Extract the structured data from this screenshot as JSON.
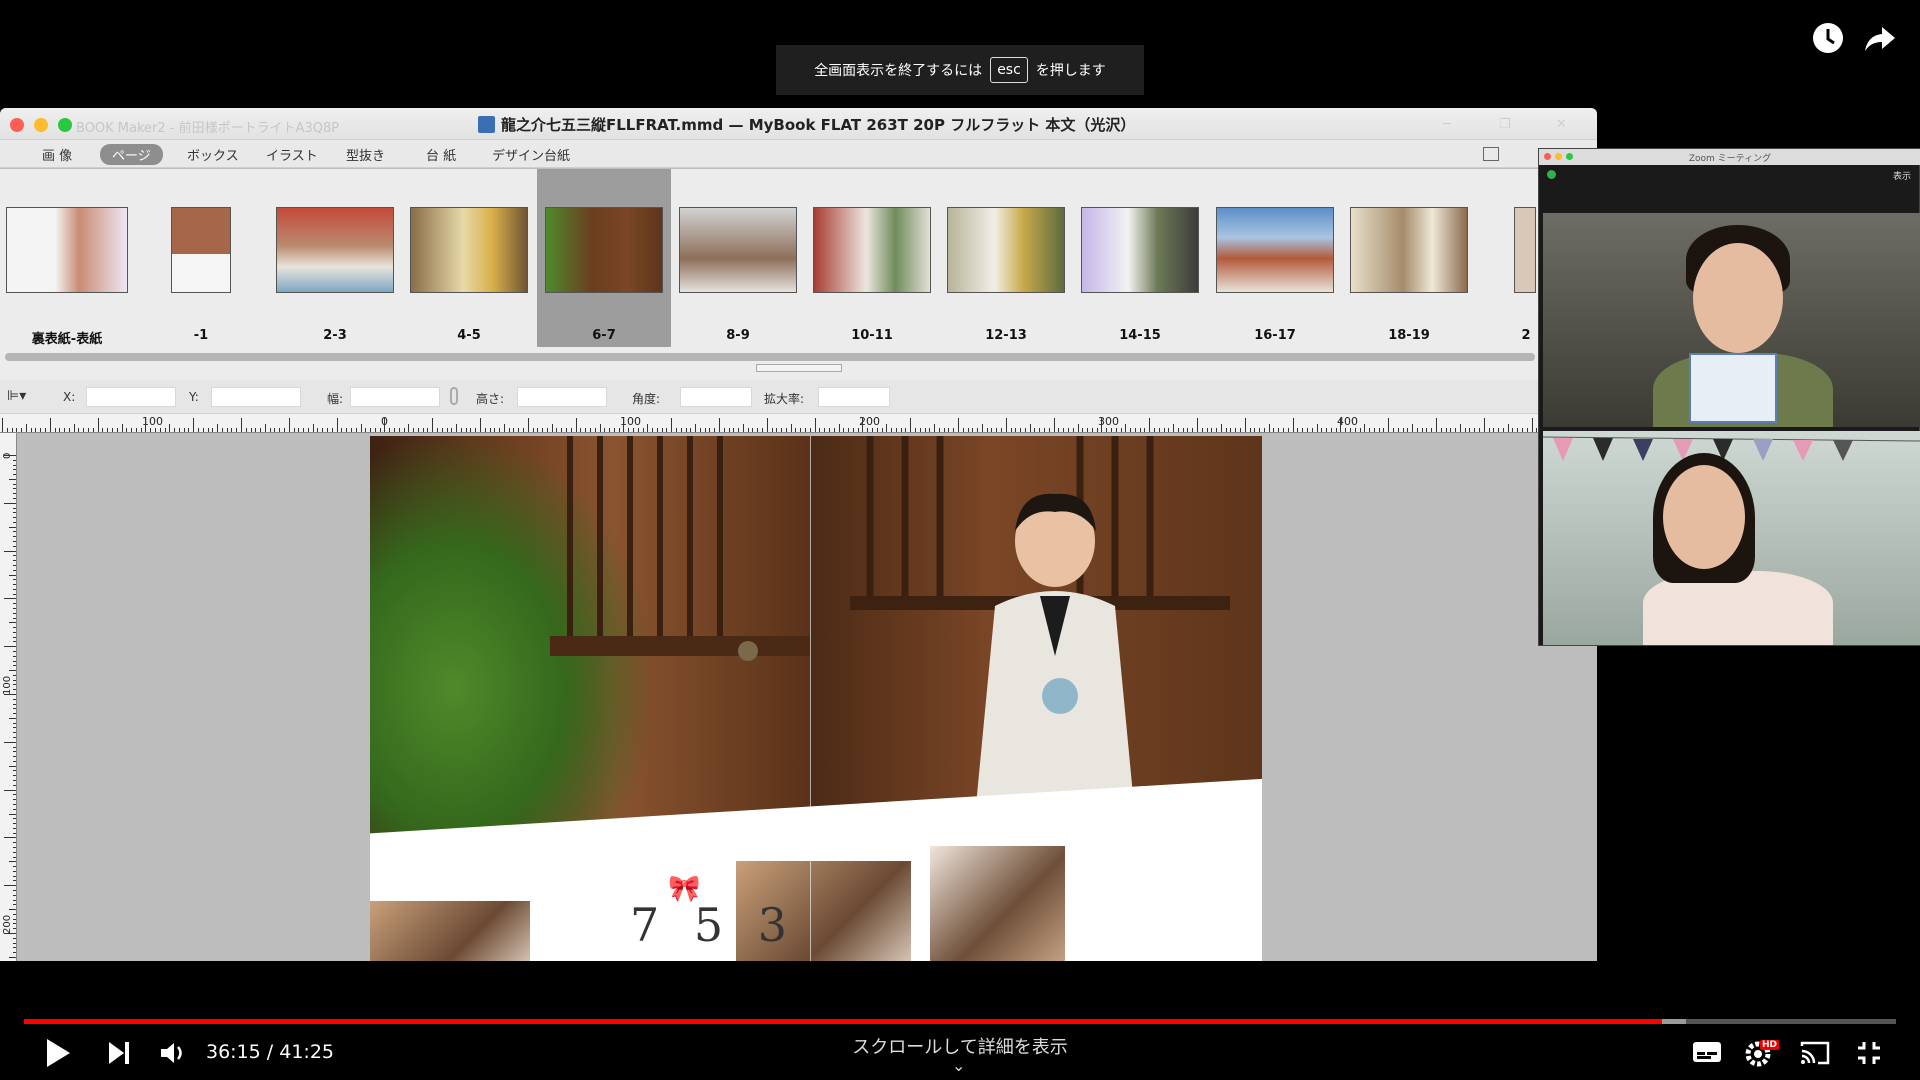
{
  "player": {
    "fullscreen_notice_prefix": "全画面表示を終了するには",
    "fullscreen_notice_key": "esc",
    "fullscreen_notice_suffix": "を押します",
    "current_time": "36:15",
    "separator": " / ",
    "duration": "41:25",
    "played_fraction": 0.875,
    "buffered_fraction": 0.888,
    "scroll_hint": "スクロールして詳細を表示",
    "quality_badge": "HD",
    "accent_color": "#ff0000"
  },
  "app": {
    "ghost_title": "BOOK Maker2 - 前田様ポートライトA3Q8P",
    "window_title": "龍之介七五三縦FLLFRAT.mmd — MyBook FLAT 263T 20P フルフラット 本文（光沢）",
    "menu": [
      {
        "label": "画 像",
        "active": false
      },
      {
        "label": "ページ",
        "active": true
      },
      {
        "label": "ボックス",
        "active": false
      },
      {
        "label": "イラスト",
        "active": false
      },
      {
        "label": "型抜き",
        "active": false
      },
      {
        "label": "台 紙",
        "active": false
      },
      {
        "label": "デザイン台紙",
        "active": false
      }
    ],
    "thumbnails": [
      {
        "label": "裏表紙-表紙"
      },
      {
        "label": "-1"
      },
      {
        "label": "2-3"
      },
      {
        "label": "4-5"
      },
      {
        "label": "6-7",
        "selected": true
      },
      {
        "label": "8-9"
      },
      {
        "label": "10-11"
      },
      {
        "label": "12-13"
      },
      {
        "label": "14-15"
      },
      {
        "label": "16-17"
      },
      {
        "label": "18-19"
      },
      {
        "label": "2"
      }
    ],
    "properties": {
      "x_label": "X:",
      "y_label": "Y:",
      "width_label": "幅:",
      "height_label": "高さ:",
      "angle_label": "角度:",
      "scale_label": "拡大率:"
    },
    "ruler_h_labels": [
      "100",
      "0",
      "100",
      "200",
      "300",
      "400"
    ],
    "ruler_v_labels": [
      "0",
      "100",
      "200"
    ],
    "page_logo": "7 5 3"
  },
  "zoom": {
    "title": "Zoom ミーティング",
    "view_label": "表示"
  }
}
